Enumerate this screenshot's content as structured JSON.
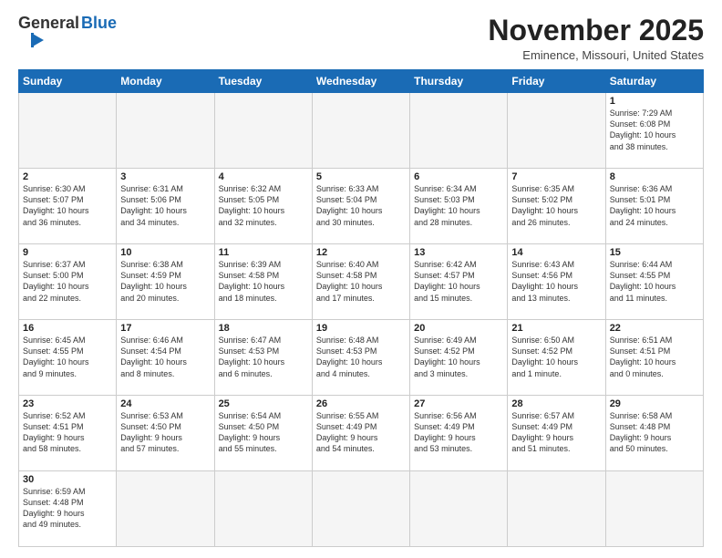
{
  "header": {
    "logo_general": "General",
    "logo_blue": "Blue",
    "month_title": "November 2025",
    "location": "Eminence, Missouri, United States"
  },
  "weekdays": [
    "Sunday",
    "Monday",
    "Tuesday",
    "Wednesday",
    "Thursday",
    "Friday",
    "Saturday"
  ],
  "weeks": [
    [
      {
        "day": "",
        "empty": true
      },
      {
        "day": "",
        "empty": true
      },
      {
        "day": "",
        "empty": true
      },
      {
        "day": "",
        "empty": true
      },
      {
        "day": "",
        "empty": true
      },
      {
        "day": "",
        "empty": true
      },
      {
        "day": "1",
        "info": "Sunrise: 7:29 AM\nSunset: 6:08 PM\nDaylight: 10 hours\nand 38 minutes."
      }
    ],
    [
      {
        "day": "2",
        "info": "Sunrise: 6:30 AM\nSunset: 5:07 PM\nDaylight: 10 hours\nand 36 minutes."
      },
      {
        "day": "3",
        "info": "Sunrise: 6:31 AM\nSunset: 5:06 PM\nDaylight: 10 hours\nand 34 minutes."
      },
      {
        "day": "4",
        "info": "Sunrise: 6:32 AM\nSunset: 5:05 PM\nDaylight: 10 hours\nand 32 minutes."
      },
      {
        "day": "5",
        "info": "Sunrise: 6:33 AM\nSunset: 5:04 PM\nDaylight: 10 hours\nand 30 minutes."
      },
      {
        "day": "6",
        "info": "Sunrise: 6:34 AM\nSunset: 5:03 PM\nDaylight: 10 hours\nand 28 minutes."
      },
      {
        "day": "7",
        "info": "Sunrise: 6:35 AM\nSunset: 5:02 PM\nDaylight: 10 hours\nand 26 minutes."
      },
      {
        "day": "8",
        "info": "Sunrise: 6:36 AM\nSunset: 5:01 PM\nDaylight: 10 hours\nand 24 minutes."
      }
    ],
    [
      {
        "day": "9",
        "info": "Sunrise: 6:37 AM\nSunset: 5:00 PM\nDaylight: 10 hours\nand 22 minutes."
      },
      {
        "day": "10",
        "info": "Sunrise: 6:38 AM\nSunset: 4:59 PM\nDaylight: 10 hours\nand 20 minutes."
      },
      {
        "day": "11",
        "info": "Sunrise: 6:39 AM\nSunset: 4:58 PM\nDaylight: 10 hours\nand 18 minutes."
      },
      {
        "day": "12",
        "info": "Sunrise: 6:40 AM\nSunset: 4:58 PM\nDaylight: 10 hours\nand 17 minutes."
      },
      {
        "day": "13",
        "info": "Sunrise: 6:42 AM\nSunset: 4:57 PM\nDaylight: 10 hours\nand 15 minutes."
      },
      {
        "day": "14",
        "info": "Sunrise: 6:43 AM\nSunset: 4:56 PM\nDaylight: 10 hours\nand 13 minutes."
      },
      {
        "day": "15",
        "info": "Sunrise: 6:44 AM\nSunset: 4:55 PM\nDaylight: 10 hours\nand 11 minutes."
      }
    ],
    [
      {
        "day": "16",
        "info": "Sunrise: 6:45 AM\nSunset: 4:55 PM\nDaylight: 10 hours\nand 9 minutes."
      },
      {
        "day": "17",
        "info": "Sunrise: 6:46 AM\nSunset: 4:54 PM\nDaylight: 10 hours\nand 8 minutes."
      },
      {
        "day": "18",
        "info": "Sunrise: 6:47 AM\nSunset: 4:53 PM\nDaylight: 10 hours\nand 6 minutes."
      },
      {
        "day": "19",
        "info": "Sunrise: 6:48 AM\nSunset: 4:53 PM\nDaylight: 10 hours\nand 4 minutes."
      },
      {
        "day": "20",
        "info": "Sunrise: 6:49 AM\nSunset: 4:52 PM\nDaylight: 10 hours\nand 3 minutes."
      },
      {
        "day": "21",
        "info": "Sunrise: 6:50 AM\nSunset: 4:52 PM\nDaylight: 10 hours\nand 1 minute."
      },
      {
        "day": "22",
        "info": "Sunrise: 6:51 AM\nSunset: 4:51 PM\nDaylight: 10 hours\nand 0 minutes."
      }
    ],
    [
      {
        "day": "23",
        "info": "Sunrise: 6:52 AM\nSunset: 4:51 PM\nDaylight: 9 hours\nand 58 minutes."
      },
      {
        "day": "24",
        "info": "Sunrise: 6:53 AM\nSunset: 4:50 PM\nDaylight: 9 hours\nand 57 minutes."
      },
      {
        "day": "25",
        "info": "Sunrise: 6:54 AM\nSunset: 4:50 PM\nDaylight: 9 hours\nand 55 minutes."
      },
      {
        "day": "26",
        "info": "Sunrise: 6:55 AM\nSunset: 4:49 PM\nDaylight: 9 hours\nand 54 minutes."
      },
      {
        "day": "27",
        "info": "Sunrise: 6:56 AM\nSunset: 4:49 PM\nDaylight: 9 hours\nand 53 minutes."
      },
      {
        "day": "28",
        "info": "Sunrise: 6:57 AM\nSunset: 4:49 PM\nDaylight: 9 hours\nand 51 minutes."
      },
      {
        "day": "29",
        "info": "Sunrise: 6:58 AM\nSunset: 4:48 PM\nDaylight: 9 hours\nand 50 minutes."
      }
    ],
    [
      {
        "day": "30",
        "info": "Sunrise: 6:59 AM\nSunset: 4:48 PM\nDaylight: 9 hours\nand 49 minutes."
      },
      {
        "day": "",
        "empty": true
      },
      {
        "day": "",
        "empty": true
      },
      {
        "day": "",
        "empty": true
      },
      {
        "day": "",
        "empty": true
      },
      {
        "day": "",
        "empty": true
      },
      {
        "day": "",
        "empty": true
      }
    ]
  ]
}
